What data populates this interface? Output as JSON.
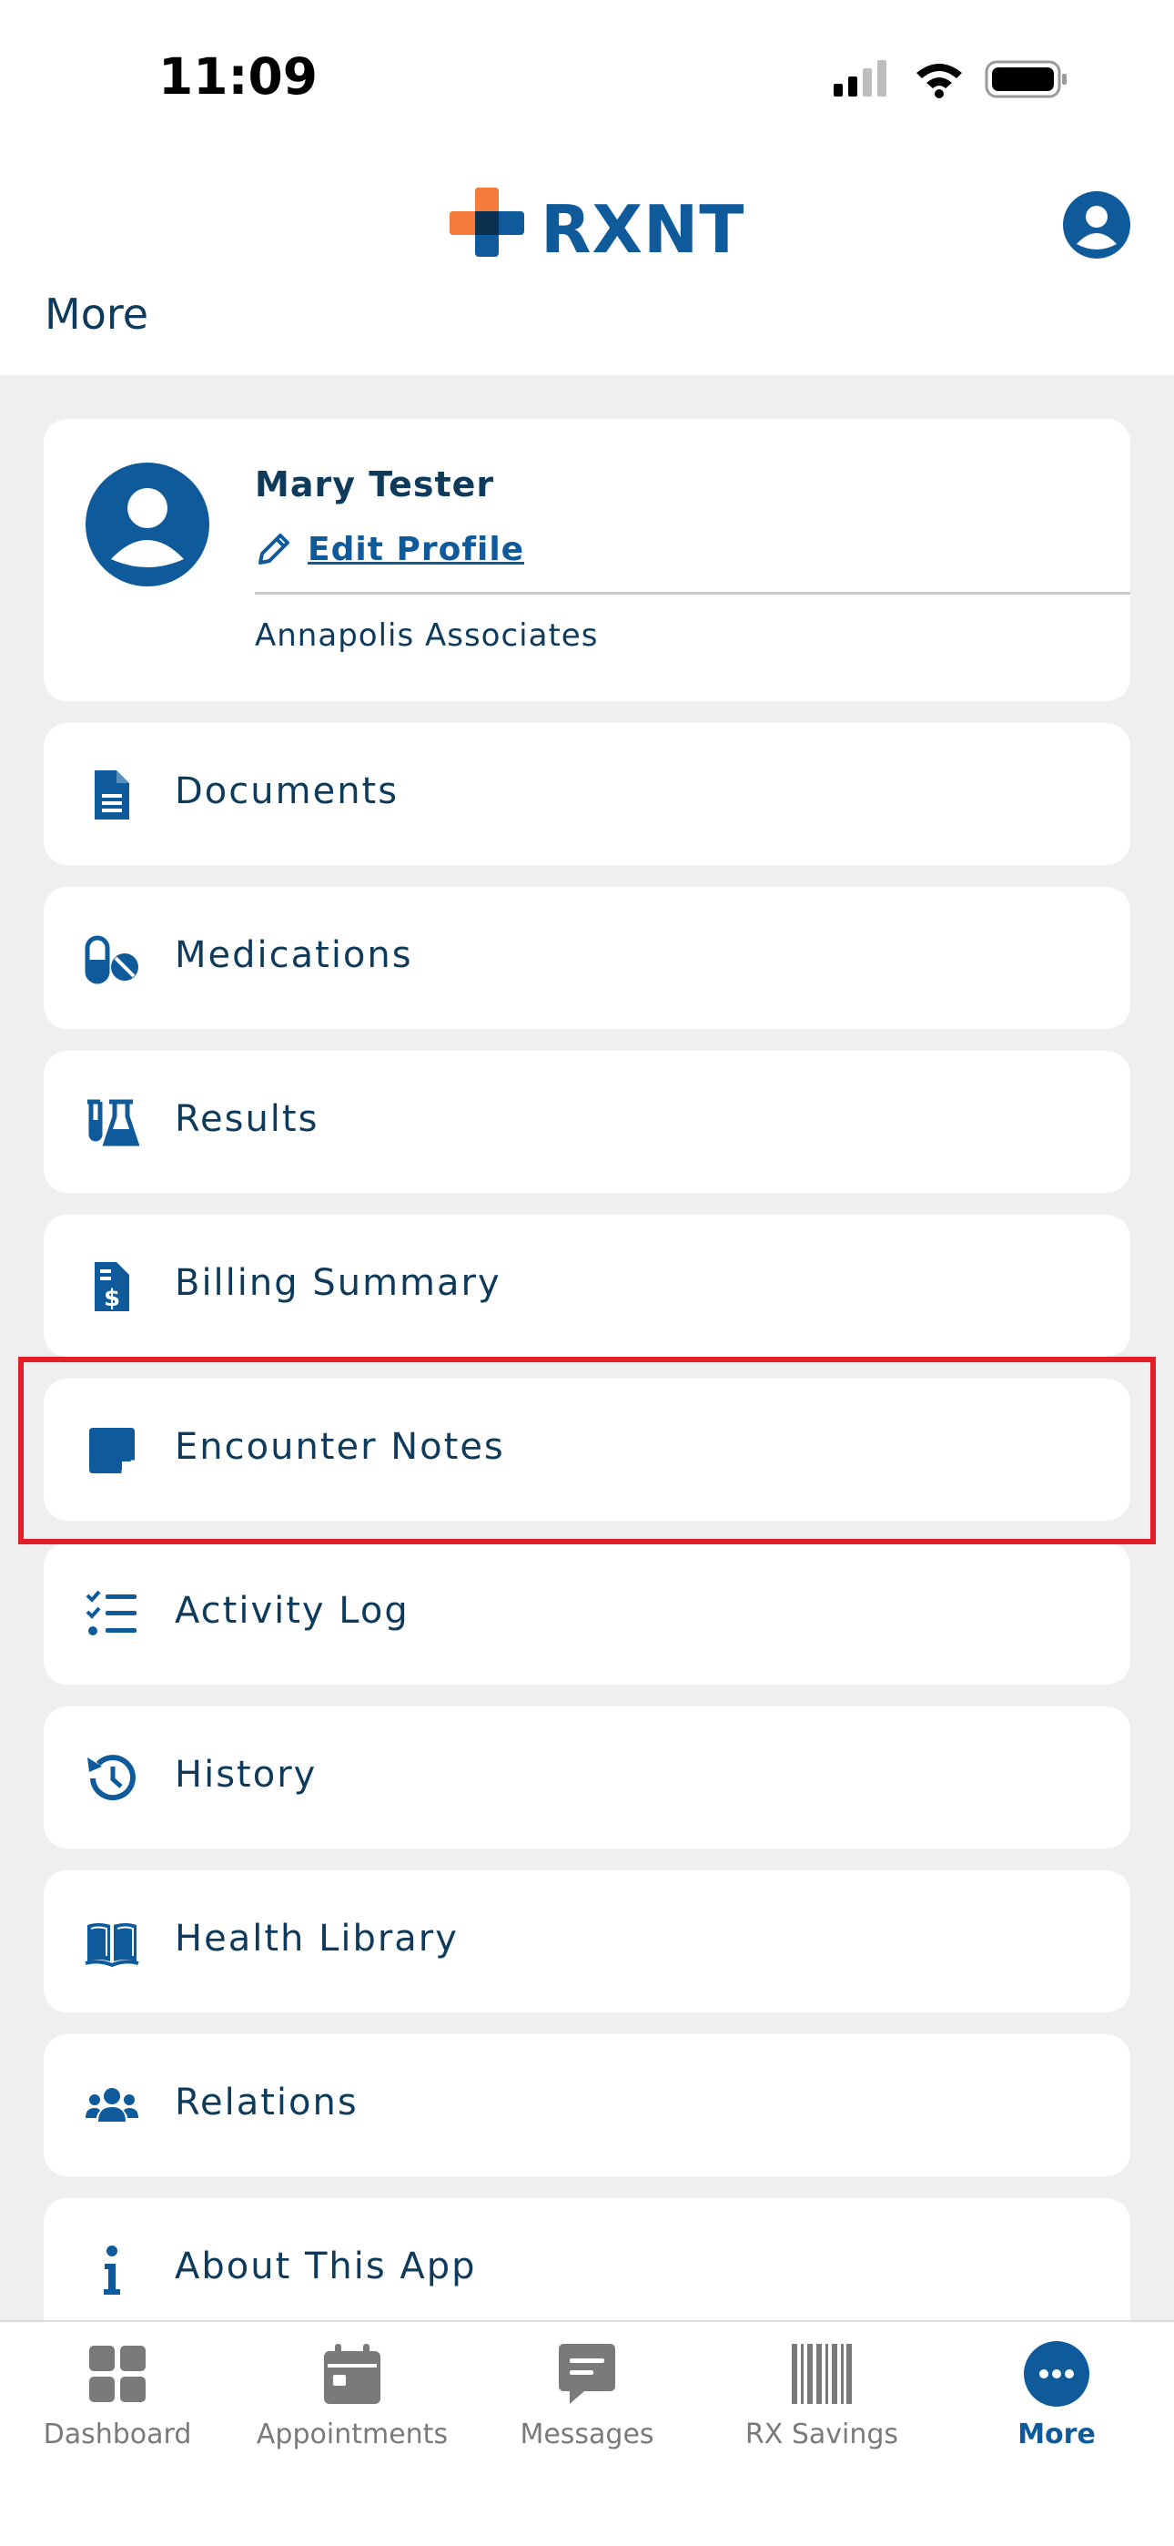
{
  "status_bar": {
    "time": "11:09"
  },
  "header": {
    "logo_text": "RXNT",
    "page_title": "More"
  },
  "profile": {
    "name": "Mary Tester",
    "edit_label": "Edit Profile",
    "organization": "Annapolis Associates"
  },
  "menu": {
    "items": [
      {
        "label": "Documents",
        "icon": "document-icon"
      },
      {
        "label": "Medications",
        "icon": "pills-icon"
      },
      {
        "label": "Results",
        "icon": "flask-icon"
      },
      {
        "label": "Billing Summary",
        "icon": "invoice-dollar-icon"
      },
      {
        "label": "Encounter Notes",
        "icon": "sticky-note-icon"
      },
      {
        "label": "Activity Log",
        "icon": "checklist-icon"
      },
      {
        "label": "History",
        "icon": "history-icon"
      },
      {
        "label": "Health Library",
        "icon": "book-icon"
      },
      {
        "label": "Relations",
        "icon": "users-icon"
      },
      {
        "label": "About This App",
        "icon": "info-icon"
      }
    ],
    "highlighted": "Encounter Notes"
  },
  "tabbar": {
    "tabs": [
      {
        "label": "Dashboard",
        "icon": "grid-icon"
      },
      {
        "label": "Appointments",
        "icon": "calendar-icon"
      },
      {
        "label": "Messages",
        "icon": "message-icon"
      },
      {
        "label": "RX Savings",
        "icon": "barcode-icon"
      },
      {
        "label": "More",
        "icon": "more-dots-icon",
        "active": true
      }
    ]
  },
  "colors": {
    "brand_blue": "#0e5a9a",
    "brand_orange": "#f47b3b",
    "text_dark": "#0e3a5c",
    "highlight_red": "#e31e26",
    "inactive_gray": "#7a7a7a"
  }
}
